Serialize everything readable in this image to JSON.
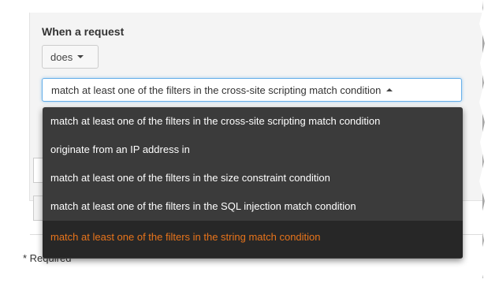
{
  "condition_section": {
    "heading": "When a request",
    "does_select": {
      "label": "does"
    },
    "condition_select": {
      "value": "match at least one of the filters in the cross-site scripting match condition",
      "options": [
        "match at least one of the filters in the cross-site scripting match condition",
        "originate from an IP address in",
        "match at least one of the filters in the size constraint condition",
        "match at least one of the filters in the SQL injection match condition",
        "match at least one of the filters in the string match condition"
      ],
      "highlighted_option": "match at least one of the filters in the string match condition"
    }
  },
  "footer": {
    "required_note": "* Required"
  },
  "colors": {
    "menu_background": "#3b3b3b",
    "menu_highlight_background": "#272727",
    "highlight_text": "#e8741b",
    "focus_border": "#66afe9"
  }
}
